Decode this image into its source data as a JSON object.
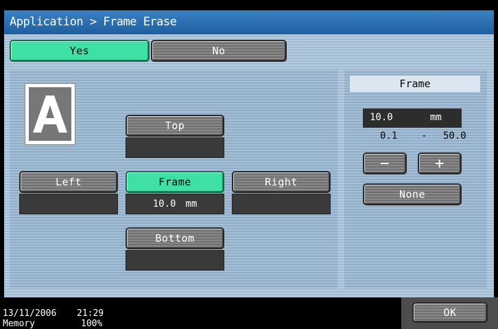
{
  "title": "Application > Frame Erase",
  "toggle": {
    "yes_label": "Yes",
    "no_label": "No"
  },
  "positions": {
    "top_label": "Top",
    "left_label": "Left",
    "frame_label": "Frame",
    "right_label": "Right",
    "bottom_label": "Bottom",
    "frame_value": "10.0",
    "frame_unit": "mm"
  },
  "doc_icon_letter": "A",
  "frame_panel": {
    "title": "Frame",
    "value": "10.0",
    "unit": "mm",
    "range_min": "0.1",
    "range_sep": "-",
    "range_max": "50.0",
    "minus_label": "−",
    "plus_label": "+",
    "none_label": "None"
  },
  "status": {
    "date": "13/11/2006",
    "time": "21:29",
    "memory_label": "Memory",
    "memory_value": "100%"
  },
  "ok_label": "OK",
  "colors": {
    "accent": "#3fe0a5",
    "title_bar": "#2a70b2",
    "panel": "#a9c3d9"
  }
}
